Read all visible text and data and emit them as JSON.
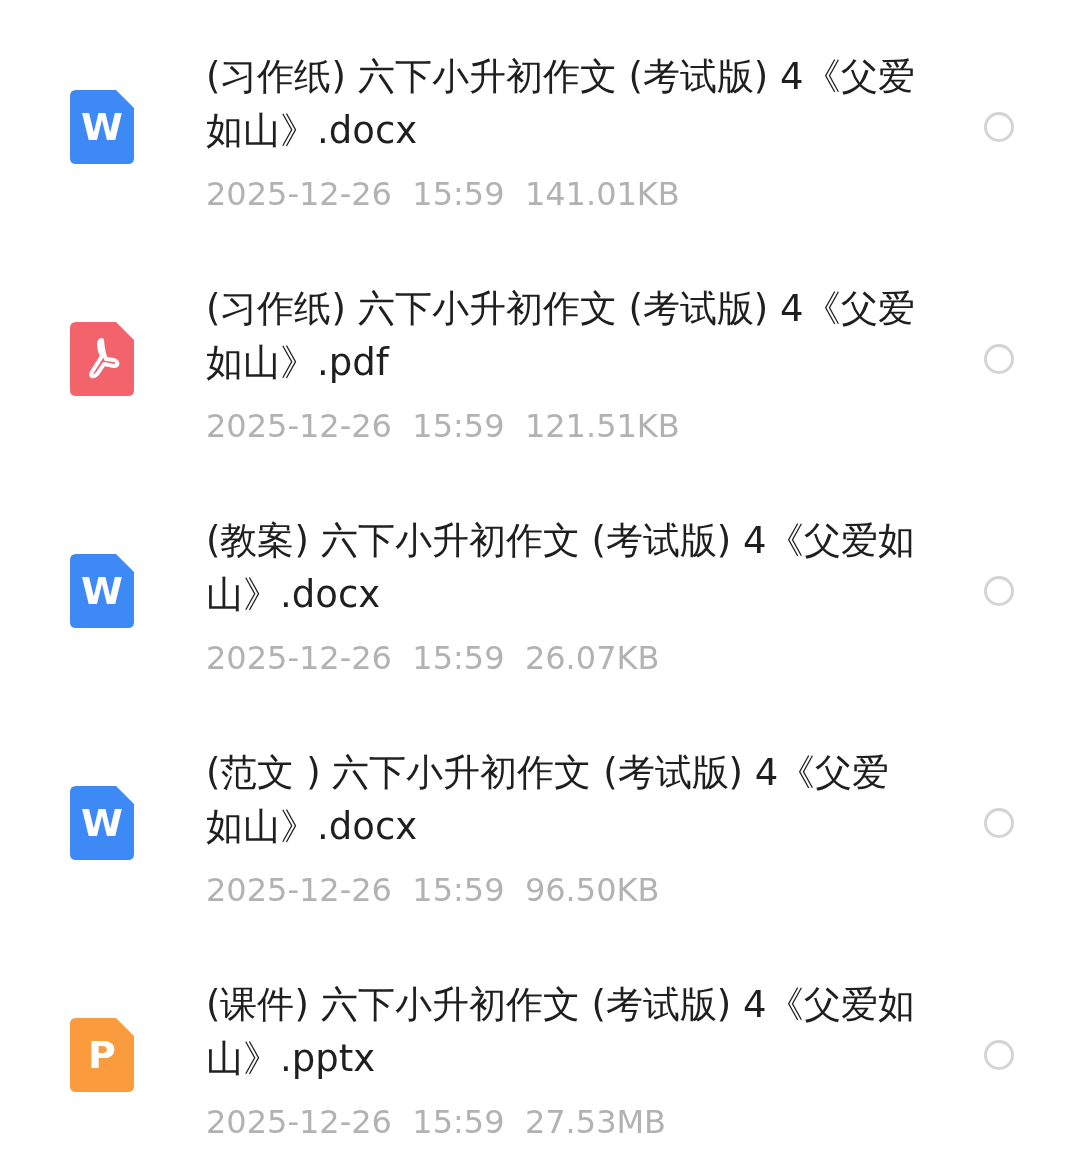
{
  "files": [
    {
      "kind": "word",
      "icon_letter": "W",
      "title": "(习作纸) 六下小升初作文 (考试版) 4《父爱如山》.docx",
      "meta": "2025-12-26  15:59  141.01KB",
      "selected": false
    },
    {
      "kind": "pdf",
      "title": "(习作纸) 六下小升初作文 (考试版) 4《父爱如山》.pdf",
      "meta": "2025-12-26  15:59  121.51KB",
      "selected": false
    },
    {
      "kind": "word",
      "icon_letter": "W",
      "title": "(教案) 六下小升初作文 (考试版) 4《父爱如山》.docx",
      "meta": "2025-12-26  15:59  26.07KB",
      "selected": false
    },
    {
      "kind": "word",
      "icon_letter": "W",
      "title": "(范文 ) 六下小升初作文 (考试版) 4《父爱如山》.docx",
      "meta": "2025-12-26  15:59  96.50KB",
      "selected": false
    },
    {
      "kind": "ppt",
      "icon_letter": "P",
      "title": "(课件) 六下小升初作文 (考试版) 4《父爱如山》.pptx",
      "meta": "2025-12-26  15:59  27.53MB",
      "selected": false
    }
  ]
}
